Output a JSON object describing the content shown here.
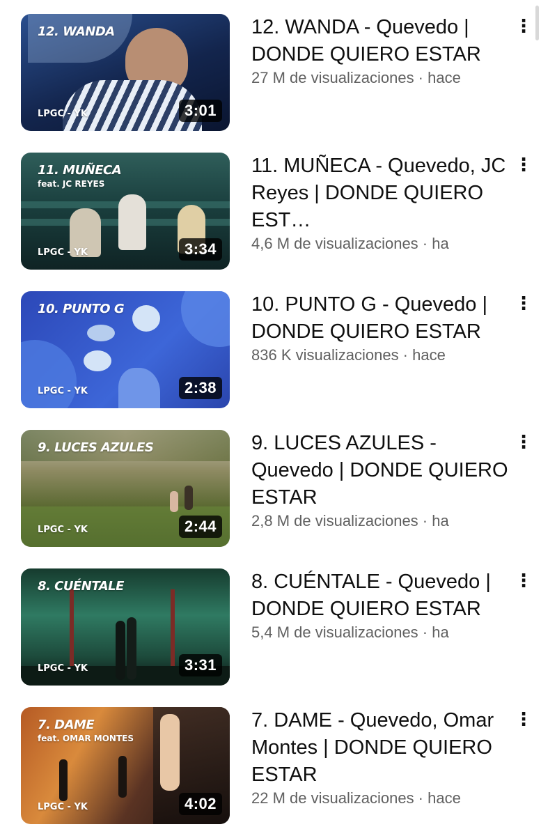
{
  "videos": [
    {
      "overlay_title": "12. WANDA",
      "overlay_feat": "",
      "overlay_label": "LPGC - YK",
      "duration": "3:01",
      "title": "12. WANDA - Quevedo | DONDE QUIERO ESTAR",
      "views": "27 M de visualizaciones · hace",
      "colors": {
        "bg1": "#1c3a6e",
        "bg2": "#0c1630",
        "accent": "#b9a08a"
      }
    },
    {
      "overlay_title": "11. MUÑECA",
      "overlay_feat": "feat. JC REYES",
      "overlay_label": "LPGC - YK",
      "duration": "3:34",
      "title": "11. MUÑECA - Quevedo, JC Reyes | DONDE QUIERO EST…",
      "views": "4,6 M de visualizaciones · ha",
      "colors": {
        "bg1": "#1f4a4a",
        "bg2": "#112a2b",
        "accent": "#d9c6a8"
      }
    },
    {
      "overlay_title": "10. PUNTO G",
      "overlay_feat": "",
      "overlay_label": "LPGC - YK",
      "duration": "2:38",
      "title": "10. PUNTO G - Quevedo | DONDE QUIERO ESTAR",
      "views": "836 K visualizaciones · hace",
      "colors": {
        "bg1": "#2f4fbf",
        "bg2": "#3a63d6",
        "accent": "#b9d3f0"
      }
    },
    {
      "overlay_title": "9. LUCES AZULES",
      "overlay_feat": "",
      "overlay_label": "LPGC - YK",
      "duration": "2:44",
      "title": "9. LUCES AZULES - Quevedo | DONDE QUIERO ESTAR",
      "views": "2,8 M de visualizaciones · ha",
      "colors": {
        "bg1": "#b8ad7e",
        "bg2": "#4f5a2e",
        "accent": "#e8dcb3"
      }
    },
    {
      "overlay_title": "8. CUÉNTALE",
      "overlay_feat": "",
      "overlay_label": "LPGC - YK",
      "duration": "3:31",
      "title": "8. CUÉNTALE - Quevedo | DONDE QUIERO ESTAR",
      "views": "5,4 M de visualizaciones · ha",
      "colors": {
        "bg1": "#2f7a62",
        "bg2": "#0d2219",
        "accent": "#8b2d2a"
      }
    },
    {
      "overlay_title": "7. DAME",
      "overlay_feat": "feat. OMAR MONTES",
      "overlay_label": "LPGC - YK",
      "duration": "4:02",
      "title": "7. DAME - Quevedo, Omar Montes | DONDE QUIERO ESTAR",
      "views": "22 M de visualizaciones · hace",
      "colors": {
        "bg1": "#c9732e",
        "bg2": "#2a1a14",
        "accent": "#f2d1a8"
      }
    }
  ],
  "icons": {
    "more": "more-vertical-icon"
  }
}
